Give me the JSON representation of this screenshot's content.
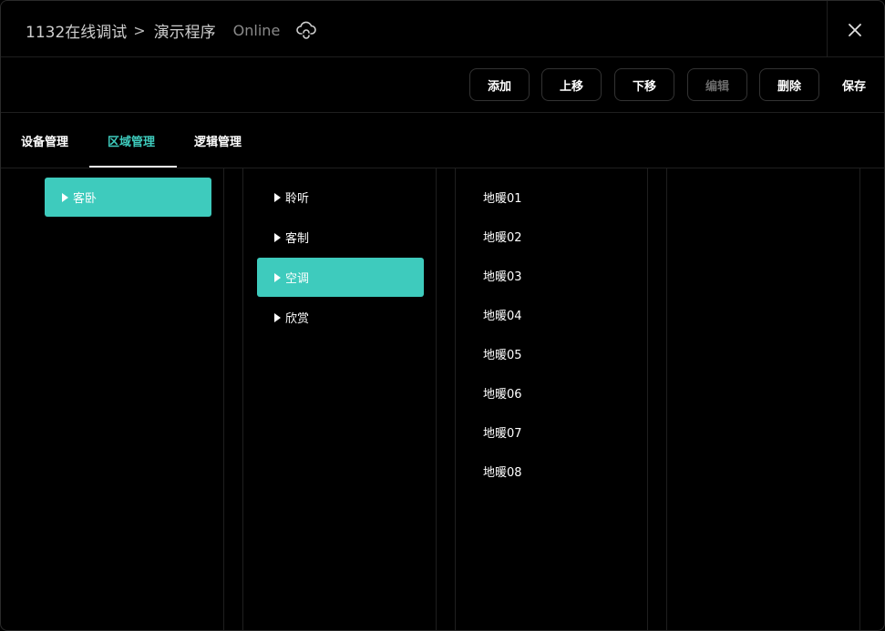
{
  "header": {
    "project": "1132在线调试",
    "separator": ">",
    "program": "演示程序",
    "status": "Online",
    "status_icon": "cloud-sync-icon",
    "close_icon": "close-icon"
  },
  "toolbar": {
    "add": "添加",
    "move_up": "上移",
    "move_down": "下移",
    "edit": "编辑",
    "delete": "删除",
    "save": "保存"
  },
  "tabs": [
    {
      "label": "设备管理",
      "active": false
    },
    {
      "label": "区域管理",
      "active": true
    },
    {
      "label": "逻辑管理",
      "active": false
    }
  ],
  "columns": {
    "areas": [
      {
        "label": "客卧",
        "selected": true
      }
    ],
    "subsystems": [
      {
        "label": "聆听",
        "selected": false
      },
      {
        "label": "客制",
        "selected": false
      },
      {
        "label": "空调",
        "selected": true
      },
      {
        "label": "欣赏",
        "selected": false
      }
    ],
    "devices": [
      "地暖01",
      "地暖02",
      "地暖03",
      "地暖04",
      "地暖05",
      "地暖06",
      "地暖07",
      "地暖08"
    ]
  },
  "colors": {
    "accent": "#3ecbbd",
    "background": "#000000",
    "border": "#1f1f1f"
  }
}
